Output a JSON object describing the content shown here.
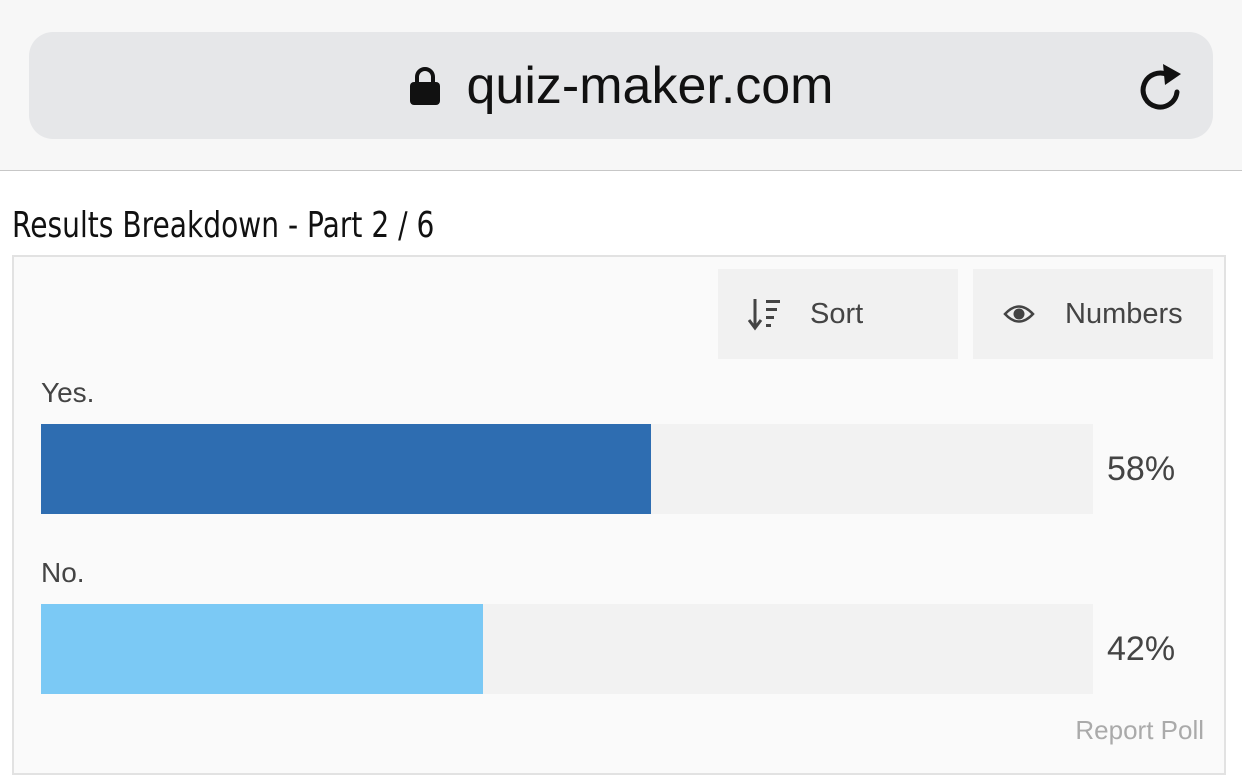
{
  "browser": {
    "url": "quiz-maker.com",
    "lock_icon": "lock-icon",
    "reload_icon": "reload-icon"
  },
  "results": {
    "title": "Results Breakdown - Part 2 / 6",
    "sort_label": "Sort",
    "sort_icon": "sort-descending-icon",
    "numbers_label": "Numbers",
    "numbers_icon": "eye-icon",
    "options": [
      {
        "label": "Yes.",
        "percent_text": "58%",
        "fraction": 0.58,
        "color": "#2e6db1"
      },
      {
        "label": "No.",
        "percent_text": "42%",
        "fraction": 0.42,
        "color": "#7bc9f5"
      }
    ],
    "report_label": "Report Poll"
  }
}
